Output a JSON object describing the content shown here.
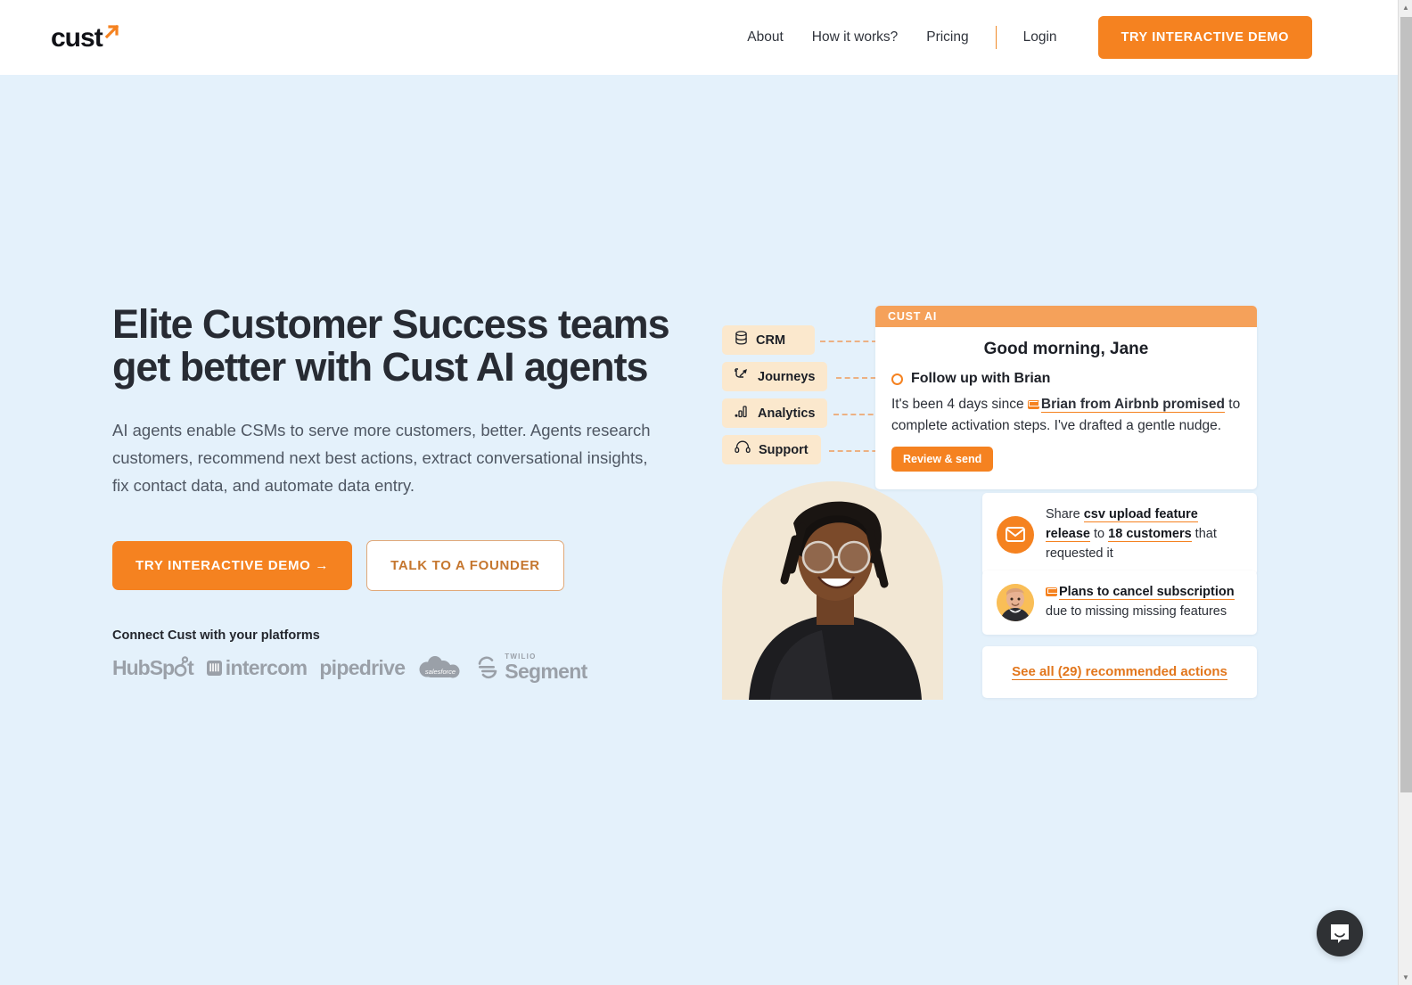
{
  "brand": {
    "logo_text": "cust",
    "accent": "#f58220",
    "accent_light": "#f5a15a",
    "chip_bg": "#fbe8cd",
    "page_bg": "#e4f1fb",
    "arch_bg": "#f2e7d4"
  },
  "header": {
    "nav": [
      {
        "label": "About"
      },
      {
        "label": "How it works?"
      },
      {
        "label": "Pricing"
      }
    ],
    "login_label": "Login",
    "cta_label": "TRY INTERACTIVE DEMO"
  },
  "hero": {
    "headline": "Elite Customer Success teams get better with Cust AI agents",
    "subheadline": "AI agents enable CSMs to serve more customers, better. Agents research customers, recommend next best actions, extract conversational insights, fix contact data, and automate data entry.",
    "primary_cta": "TRY INTERACTIVE DEMO →",
    "secondary_cta": "TALK TO A FOUNDER",
    "platforms_label": "Connect Cust with your platforms",
    "platforms": [
      {
        "name": "HubSpot",
        "icon": "hubspot-logo"
      },
      {
        "name": "intercom",
        "icon": "intercom-logo"
      },
      {
        "name": "pipedrive",
        "icon": "pipedrive-logo"
      },
      {
        "name": "salesforce",
        "icon": "salesforce-logo"
      },
      {
        "name": "Segment",
        "icon": "twilio-segment-logo",
        "eyebrow": "TWILIO"
      }
    ]
  },
  "visual": {
    "chips": [
      {
        "label": "CRM",
        "icon": "database-icon"
      },
      {
        "label": "Journeys",
        "icon": "journey-arrow-icon"
      },
      {
        "label": "Analytics",
        "icon": "bar-chart-icon"
      },
      {
        "label": "Support",
        "icon": "headset-icon"
      }
    ],
    "ai_card": {
      "badge": "CUST AI",
      "greeting": "Good morning, Jane",
      "task_title": "Follow up with Brian",
      "body_prefix": "It's been 4 days since ",
      "body_highlight": "Brian from Airbnb promised",
      "body_suffix": " to complete activation steps. I've drafted a gentle nudge.",
      "button_label": "Review & send"
    },
    "actions": [
      {
        "icon": "envelope-icon",
        "prefix": "Share ",
        "highlight1": "csv upload feature release",
        "middle": " to ",
        "highlight2": "18 customers",
        "suffix": " that requested it"
      },
      {
        "icon": "avatar",
        "title": "Plans to cancel subscription",
        "subtitle": "due to missing missing features"
      }
    ],
    "see_all_label": "See all (29) recommended actions"
  },
  "widgets": {
    "chat_launcher": "intercom-chat-icon"
  }
}
